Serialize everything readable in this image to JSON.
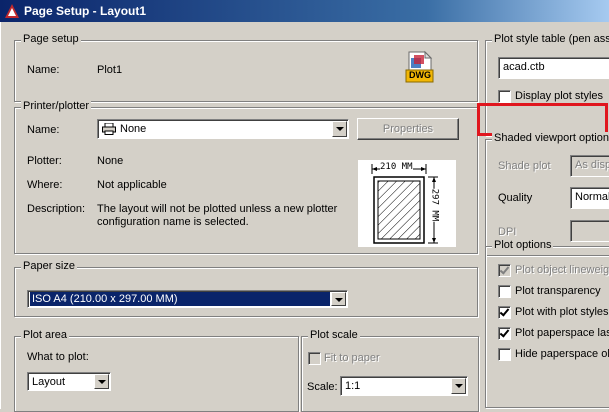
{
  "window": {
    "title": "Page Setup - Layout1"
  },
  "page_setup": {
    "legend": "Page setup",
    "name_label": "Name:",
    "name_value": "Plot1",
    "dwg_badge": "DWG"
  },
  "printer_plotter": {
    "legend": "Printer/plotter",
    "name_label": "Name:",
    "name_value": "None",
    "properties_label": "Properties",
    "plotter_label": "Plotter:",
    "plotter_value": "None",
    "where_label": "Where:",
    "where_value": "Not applicable",
    "description_label": "Description:",
    "description_line1": "The layout will not be plotted unless a new plotter",
    "description_line2": "configuration name is selected.",
    "preview_width": "210 MM",
    "preview_height": "297 MM"
  },
  "paper_size": {
    "legend": "Paper size",
    "value": "ISO A4 (210.00 x 297.00 MM)"
  },
  "plot_area": {
    "legend": "Plot area",
    "what_label": "What to plot:",
    "what_value": "Layout"
  },
  "plot_scale": {
    "legend": "Plot scale",
    "fit_label": "Fit to paper",
    "scale_label": "Scale:",
    "scale_value": "1:1"
  },
  "plot_style_table": {
    "legend": "Plot style table (pen ass",
    "value": "acad.ctb",
    "display_label": "Display plot styles"
  },
  "shaded_viewport": {
    "legend": "Shaded viewport option",
    "shade_label": "Shade plot",
    "shade_value": "As disp",
    "quality_label": "Quality",
    "quality_value": "Normal",
    "dpi_label": "DPI"
  },
  "plot_options": {
    "legend": "Plot options",
    "items": [
      {
        "label": "Plot object lineweig",
        "checked": true,
        "enabled": false
      },
      {
        "label": "Plot transparency",
        "checked": false,
        "enabled": true
      },
      {
        "label": "Plot with plot styles",
        "checked": true,
        "enabled": true
      },
      {
        "label": "Plot paperspace las",
        "checked": true,
        "enabled": true
      },
      {
        "label": "Hide paperspace ol",
        "checked": false,
        "enabled": true
      }
    ]
  },
  "colors": {
    "title_start": "#0a246a",
    "title_end": "#a6caf0",
    "dialog_bg": "#d4d0c8",
    "highlight": "#e0161e"
  }
}
